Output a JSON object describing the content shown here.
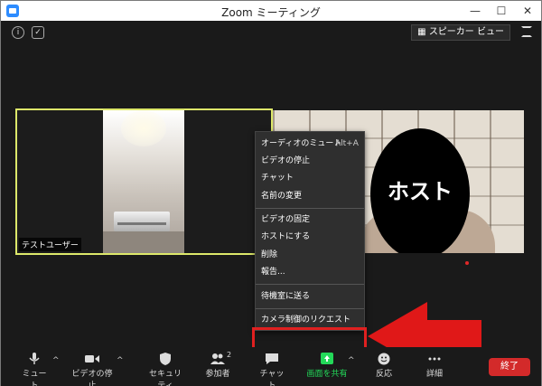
{
  "window": {
    "title": "Zoom ミーティング",
    "min": "—",
    "max": "☐",
    "close": "✕"
  },
  "top": {
    "speaker_view": "スピーカー ビュー"
  },
  "tiles": {
    "user_label": "テストユーザー",
    "host_name": "ホスト"
  },
  "context_menu": {
    "items": [
      "オーディオのミュート",
      "ビデオの停止",
      "チャット",
      "名前の変更",
      "ビデオの固定",
      "ホストにする",
      "削除",
      "報告...",
      "待機室に送る",
      "カメラ制御のリクエスト"
    ],
    "mute_shortcut": "Alt+A"
  },
  "toolbar": {
    "mute": "ミュート",
    "video_stop": "ビデオの停止",
    "security": "セキュリティ",
    "participants": "参加者",
    "participants_count": "2",
    "chat": "チャット",
    "share": "画面を共有",
    "reactions": "反応",
    "more": "詳細",
    "end": "終了"
  },
  "colors": {
    "share_green": "#23d959",
    "end_red": "#d32a2a",
    "highlight_red": "#e02020",
    "active_speaker": "#dde86a"
  }
}
